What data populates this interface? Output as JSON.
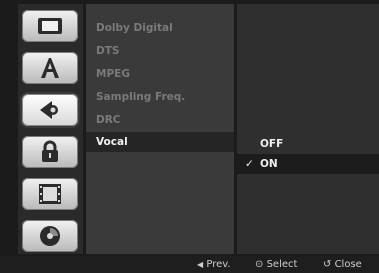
{
  "menu": {
    "items": [
      {
        "label": "Dolby Digital"
      },
      {
        "label": "DTS"
      },
      {
        "label": "MPEG"
      },
      {
        "label": "Sampling Freq."
      },
      {
        "label": "DRC"
      },
      {
        "label": "Vocal"
      }
    ],
    "selected_index": 5
  },
  "options": {
    "items": [
      {
        "label": "OFF"
      },
      {
        "label": "ON",
        "checked": true
      }
    ],
    "check_glyph": "✓",
    "selected_index": 1
  },
  "icons": [
    "display-icon",
    "language-icon",
    "audio-icon",
    "lock-icon",
    "recording-icon",
    "disc-icon"
  ],
  "active_icon": "audio-icon",
  "help_bar": {
    "prev_glyph": "◀",
    "prev_label": "Prev.",
    "select_glyph": "⊙",
    "select_label": "Select",
    "close_glyph": "↺",
    "close_label": "Close"
  }
}
